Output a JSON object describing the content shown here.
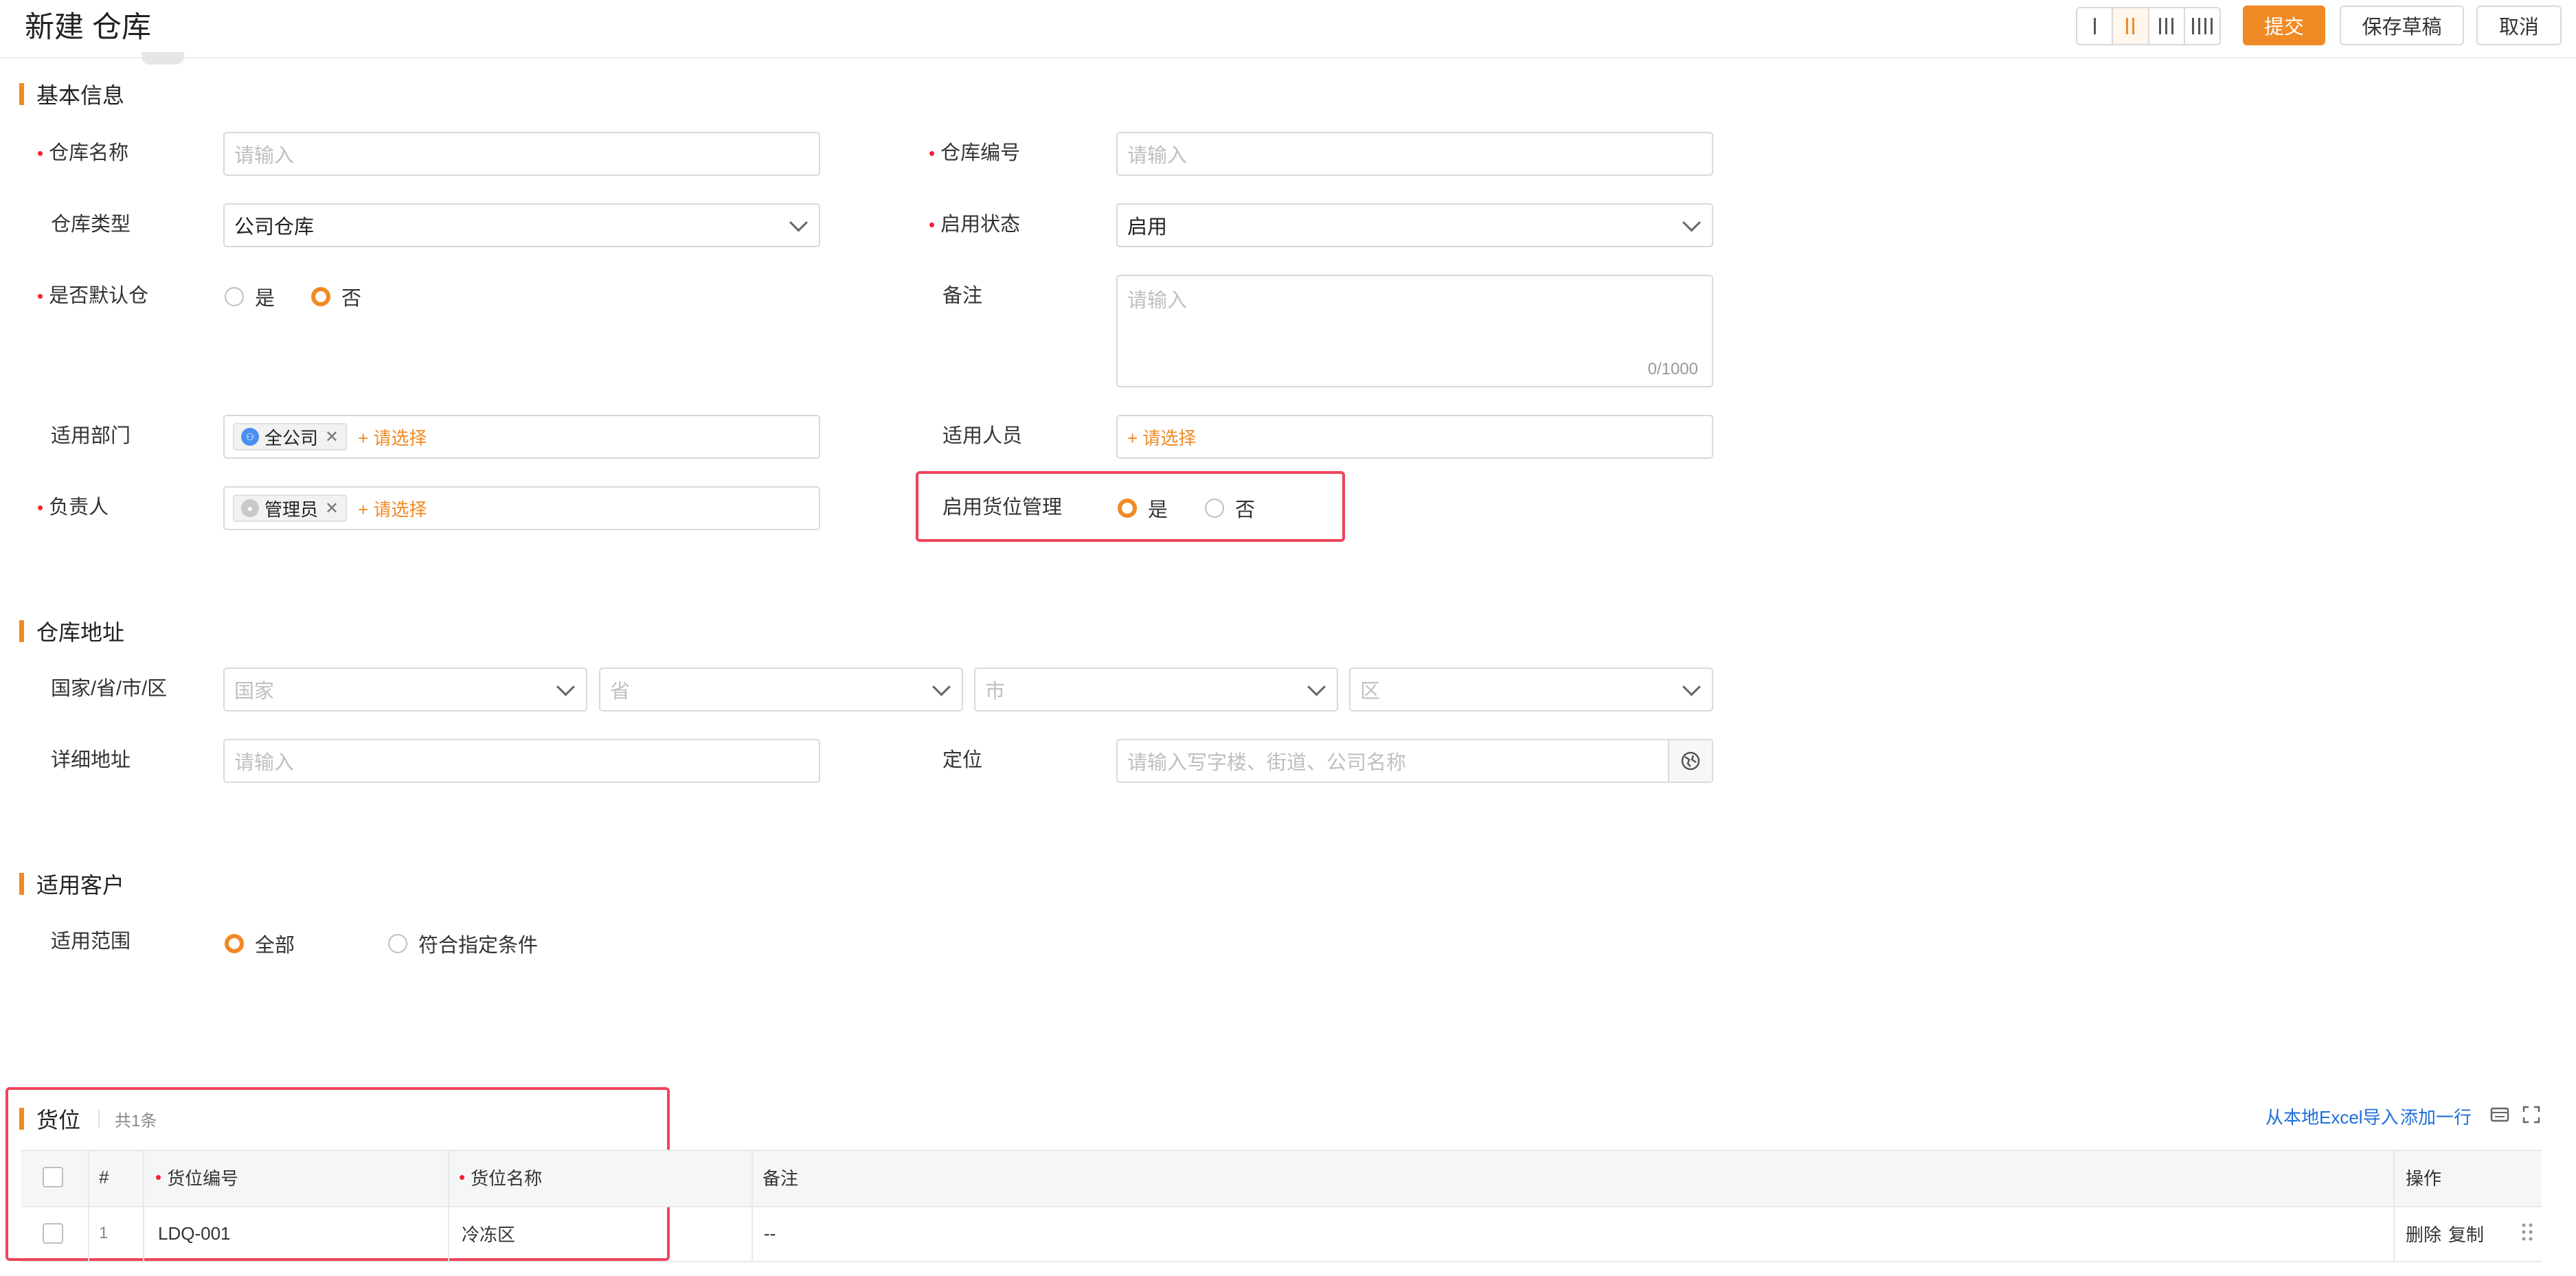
{
  "header": {
    "title": "新建 仓库",
    "submit_label": "提交",
    "save_draft_label": "保存草稿",
    "cancel_label": "取消",
    "column_layout_options": [
      "1-column",
      "2-column",
      "3-column",
      "4-column"
    ],
    "column_layout_selected": "2-column"
  },
  "basic": {
    "section_title": "基本信息",
    "warehouse_name": {
      "label": "仓库名称",
      "placeholder": "请输入",
      "required": true
    },
    "warehouse_code": {
      "label": "仓库编号",
      "placeholder": "请输入",
      "required": true
    },
    "warehouse_type": {
      "label": "仓库类型",
      "value": "公司仓库"
    },
    "enable_status": {
      "label": "启用状态",
      "value": "启用",
      "required": true
    },
    "is_default": {
      "label": "是否默认仓",
      "required": true,
      "options": [
        "是",
        "否"
      ],
      "selected": "否"
    },
    "remark": {
      "label": "备注",
      "placeholder": "请输入",
      "counter": "0/1000"
    },
    "department": {
      "label": "适用部门",
      "tag": "全公司",
      "add_label": "+ 请选择"
    },
    "personnel": {
      "label": "适用人员",
      "add_label": "+ 请选择"
    },
    "owner": {
      "label": "负责人",
      "required": true,
      "tag": "管理员",
      "add_label": "+ 请选择"
    },
    "location_mgmt": {
      "label": "启用货位管理",
      "options": [
        "是",
        "否"
      ],
      "selected": "是"
    }
  },
  "address": {
    "section_title": "仓库地址",
    "region_label": "国家/省/市/区",
    "country_placeholder": "国家",
    "province_placeholder": "省",
    "city_placeholder": "市",
    "district_placeholder": "区",
    "detail_label": "详细地址",
    "detail_placeholder": "请输入",
    "locate_label": "定位",
    "locate_placeholder": "请输入写字楼、街道、公司名称"
  },
  "customers": {
    "section_title": "适用客户",
    "scope_label": "适用范围",
    "options": [
      "全部",
      "符合指定条件"
    ],
    "selected": "全部"
  },
  "locations": {
    "section_title": "货位",
    "count_text": "共1条",
    "import_label": "从本地Excel导入",
    "add_row_label": "添加一行",
    "columns": [
      "#",
      "货位编号",
      "货位名称",
      "备注",
      "操作"
    ],
    "rows": [
      {
        "index": "1",
        "code": "LDQ-001",
        "name": "冷冻区",
        "remark": "--",
        "delete_label": "删除",
        "copy_label": "复制"
      }
    ]
  },
  "colors": {
    "accent": "#f08a24",
    "highlight": "#f0445a",
    "link": "#1e6fd9",
    "required": "#f5222d"
  }
}
